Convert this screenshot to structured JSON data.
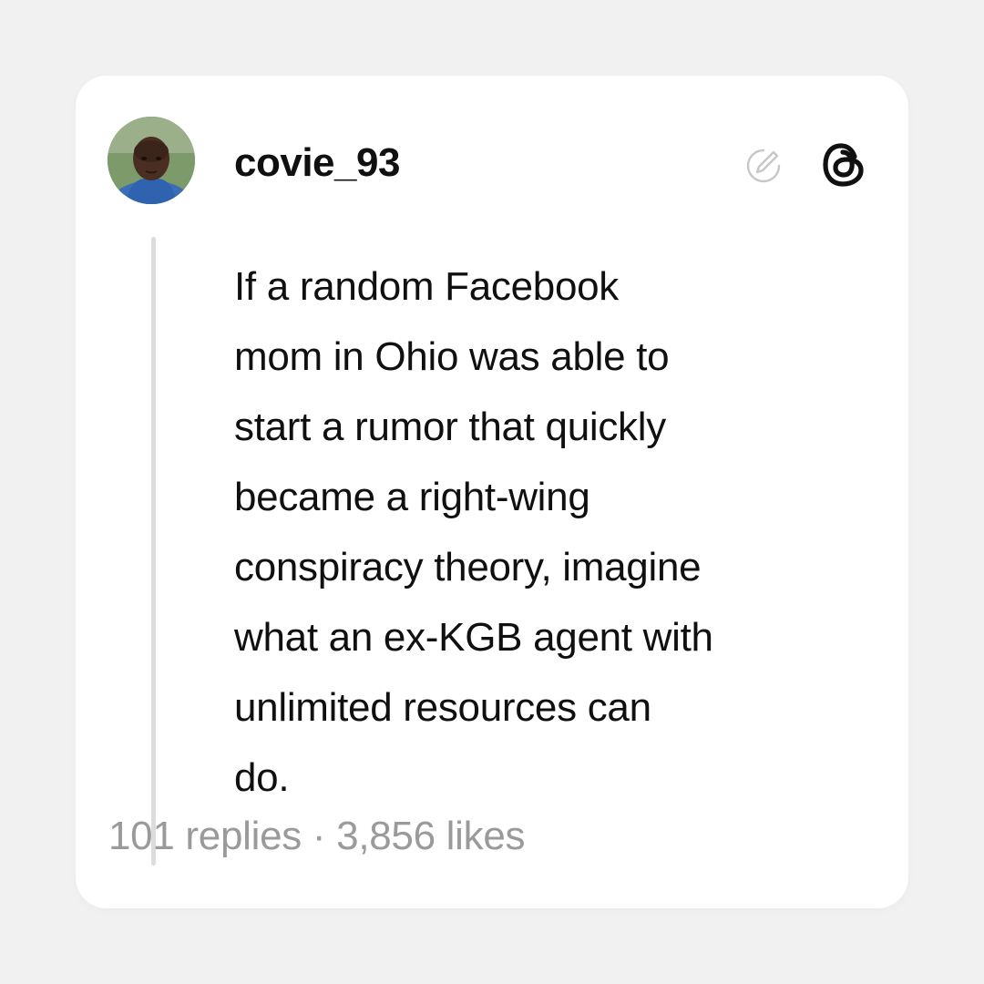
{
  "post": {
    "username": "covie_93",
    "text_lines": [
      "If a random Facebook",
      "mom in Ohio was able to",
      "start a rumor that quickly",
      "became a right-wing",
      "conspiracy theory, imagine",
      "what an ex-KGB agent with",
      "unlimited resources can",
      "do."
    ],
    "stats": "101 replies · 3,856 likes"
  },
  "icons": {
    "edited": "edited-icon",
    "app": "threads-logo-icon",
    "avatar": "avatar-photo"
  },
  "colors": {
    "background": "#f1f1f1",
    "card": "#ffffff",
    "text": "#101010",
    "muted": "#9a9a9a",
    "thread_line": "#dcdcdc"
  }
}
